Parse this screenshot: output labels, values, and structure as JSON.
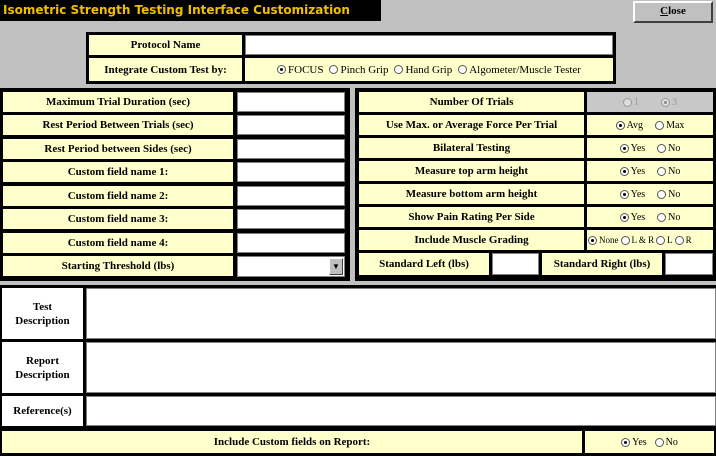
{
  "window": {
    "title": "Isometric Strength Testing Interface Customization",
    "close_prefix": "C",
    "close_rest": "lose"
  },
  "protocol": {
    "name_label": "Protocol Name",
    "name_value": "",
    "integrate_label": "Integrate Custom Test by:",
    "integrate_options": [
      {
        "label": "FOCUS",
        "selected": true
      },
      {
        "label": "Pinch Grip",
        "selected": false
      },
      {
        "label": "Hand Grip",
        "selected": false
      },
      {
        "label": "Algometer/Muscle Tester",
        "selected": false
      }
    ]
  },
  "left_fields": [
    {
      "label": "Maximum Trial Duration (sec)",
      "value": ""
    },
    {
      "label": "Rest Period Between Trials (sec)",
      "value": ""
    },
    {
      "label": "Rest Period between Sides (sec)",
      "value": ""
    },
    {
      "label": "Custom field name 1:",
      "value": ""
    },
    {
      "label": "Custom field name 2:",
      "value": ""
    },
    {
      "label": "Custom field name 3:",
      "value": ""
    },
    {
      "label": "Custom field name 4:",
      "value": ""
    },
    {
      "label": "Starting Threshold (lbs)",
      "value": ""
    }
  ],
  "right_options": {
    "trials": {
      "label": "Number Of Trials",
      "options": [
        {
          "label": "1",
          "selected": false
        },
        {
          "label": "3",
          "selected": true
        }
      ]
    },
    "force": {
      "label": "Use Max. or Average Force Per Trial",
      "options": [
        {
          "label": "Avg",
          "selected": true
        },
        {
          "label": "Max",
          "selected": false
        }
      ]
    },
    "bilateral": {
      "label": "Bilateral Testing",
      "options": [
        {
          "label": "Yes",
          "selected": true
        },
        {
          "label": "No",
          "selected": false
        }
      ]
    },
    "top_arm": {
      "label": "Measure top arm height",
      "options": [
        {
          "label": "Yes",
          "selected": true
        },
        {
          "label": "No",
          "selected": false
        }
      ]
    },
    "bottom_arm": {
      "label": "Measure bottom arm height",
      "options": [
        {
          "label": "Yes",
          "selected": true
        },
        {
          "label": "No",
          "selected": false
        }
      ]
    },
    "pain": {
      "label": "Show Pain Rating Per Side",
      "options": [
        {
          "label": "Yes",
          "selected": true
        },
        {
          "label": "No",
          "selected": false
        }
      ]
    },
    "muscle": {
      "label": "Include Muscle Grading",
      "options": [
        {
          "label": "None",
          "selected": true
        },
        {
          "label": "L & R",
          "selected": false
        },
        {
          "label": "L",
          "selected": false
        },
        {
          "label": "R",
          "selected": false
        }
      ]
    }
  },
  "standard": {
    "left_label": "Standard Left (lbs)",
    "left_value": "",
    "right_label": "Standard Right (lbs)",
    "right_value": ""
  },
  "descriptions": {
    "test_line1": "Test",
    "test_line2": "Description",
    "report_line1": "Report",
    "report_line2": "Description",
    "reference": "Reference(s)"
  },
  "report_custom": {
    "label": "Include Custom fields on Report:",
    "options": [
      {
        "label": "Yes",
        "selected": true
      },
      {
        "label": "No",
        "selected": false
      }
    ]
  }
}
